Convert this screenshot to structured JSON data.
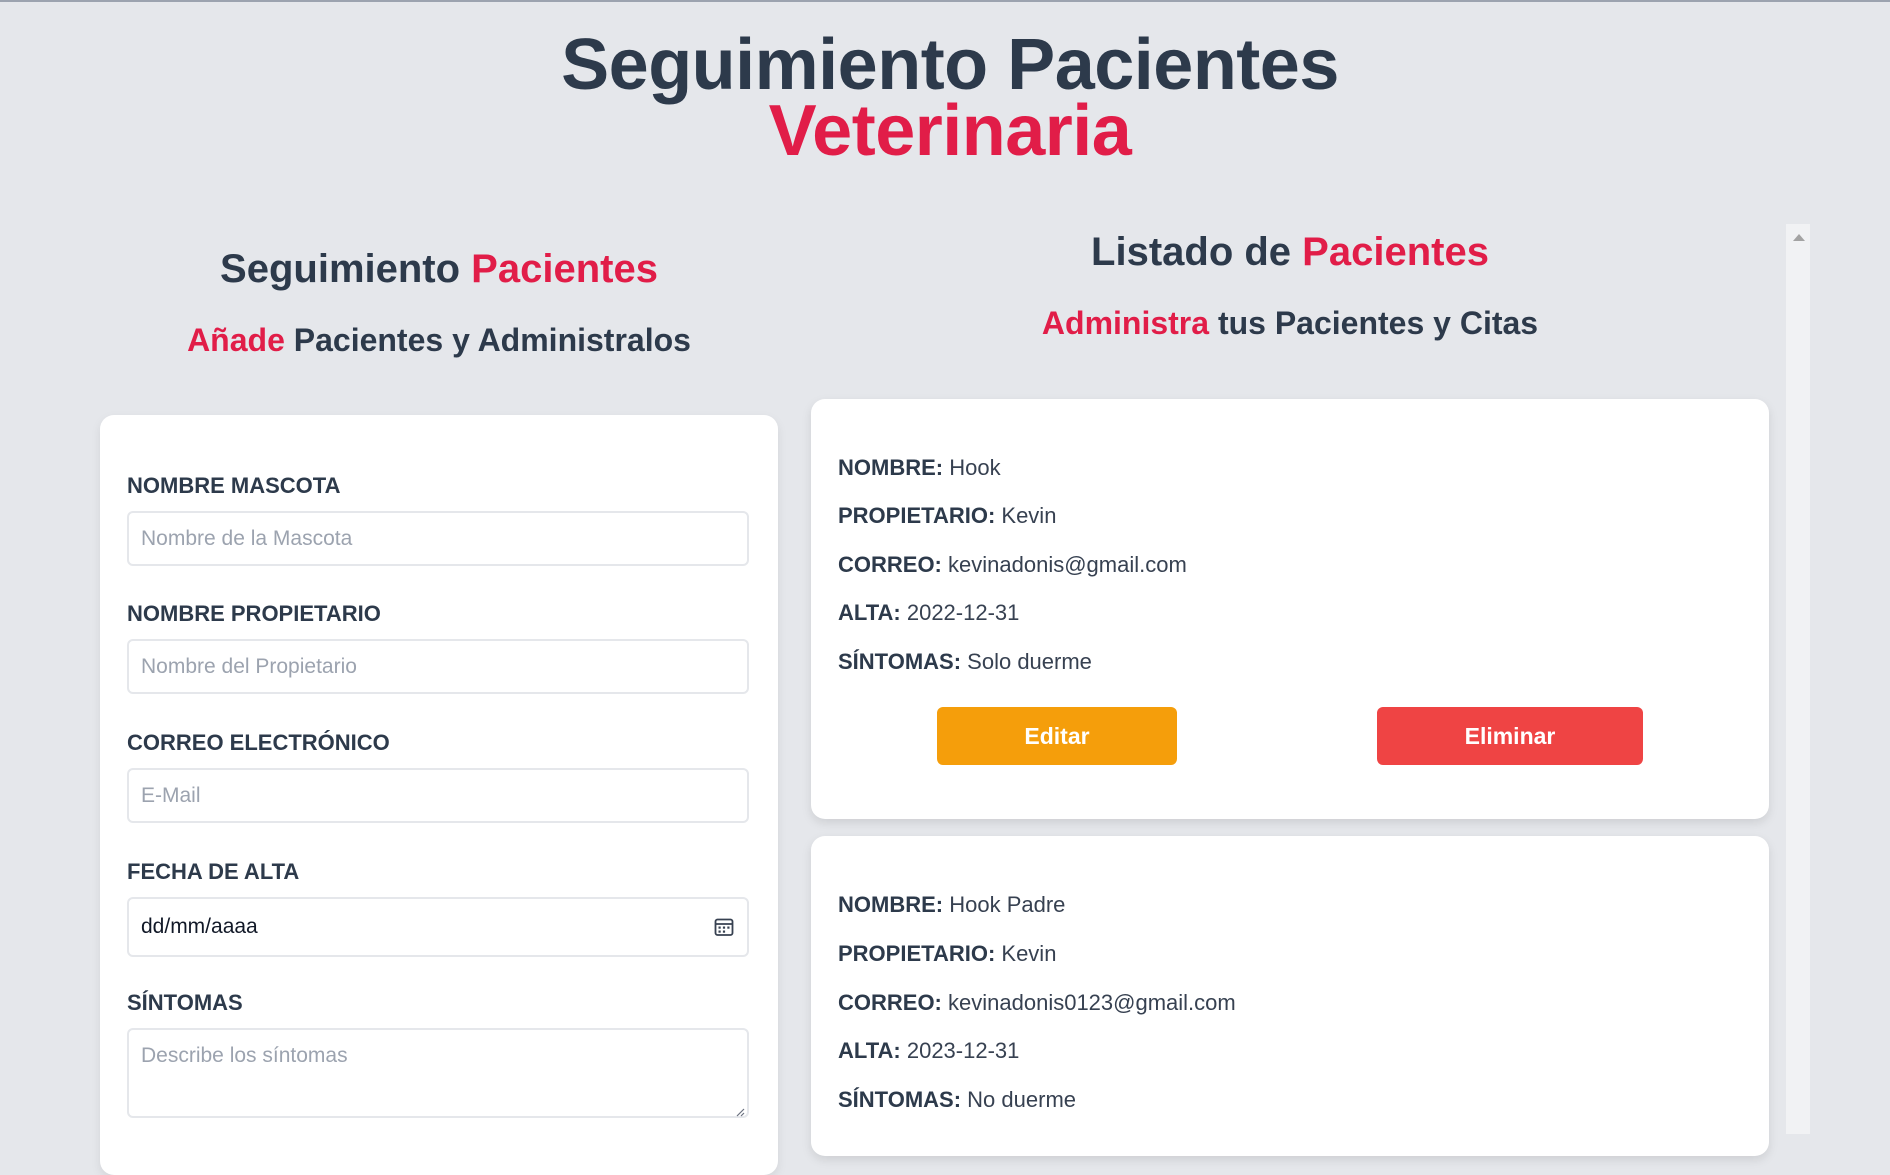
{
  "header": {
    "title_line1": "Seguimiento Pacientes",
    "title_line2": "Veterinaria"
  },
  "form_section": {
    "heading_part1": "Seguimiento ",
    "heading_part2": "Pacientes",
    "sub_part1": "Añade",
    "sub_part2": " Pacientes y Administralos",
    "fields": [
      {
        "label": "NOMBRE MASCOTA",
        "placeholder": "Nombre de la Mascota",
        "value": ""
      },
      {
        "label": "NOMBRE PROPIETARIO",
        "placeholder": "Nombre del Propietario",
        "value": ""
      },
      {
        "label": "CORREO ELECTRÓNICO",
        "placeholder": "E-Mail",
        "value": ""
      },
      {
        "label": "FECHA DE ALTA",
        "placeholder": "dd/mm/aaaa",
        "value": "dd/mm/aaaa"
      },
      {
        "label": "SÍNTOMAS",
        "placeholder": "Describe los síntomas",
        "value": ""
      }
    ]
  },
  "list_section": {
    "heading_part1": "Listado de ",
    "heading_part2": "Pacientes",
    "sub_part1": "Administra",
    "sub_part2": " tus Pacientes y Citas",
    "patients": [
      {
        "nombre_label": "NOMBRE:",
        "nombre": "Hook",
        "propietario_label": "PROPIETARIO:",
        "propietario": "Kevin",
        "correo_label": "CORREO:",
        "correo": "kevinadonis@gmail.com",
        "alta_label": "ALTA:",
        "alta": "2022-12-31",
        "sintomas_label": "SÍNTOMAS:",
        "sintomas": "Solo duerme",
        "edit_label": "Editar",
        "delete_label": "Eliminar"
      },
      {
        "nombre_label": "NOMBRE:",
        "nombre": "Hook Padre",
        "propietario_label": "PROPIETARIO:",
        "propietario": "Kevin",
        "correo_label": "CORREO:",
        "correo": "kevinadonis0123@gmail.com",
        "alta_label": "ALTA:",
        "alta": "2023-12-31",
        "sintomas_label": "SÍNTOMAS:",
        "sintomas": "No duerme"
      }
    ]
  },
  "colors": {
    "background": "#e5e7eb",
    "dark_text": "#2d3a4b",
    "accent_red": "#e11d48",
    "edit_button": "#f59e0b",
    "delete_button": "#ef4444"
  },
  "icons": {
    "date_picker": "calendar-icon",
    "scroll_up": "scroll-up-arrow-icon",
    "textarea_resize": "resize-grip-icon"
  }
}
